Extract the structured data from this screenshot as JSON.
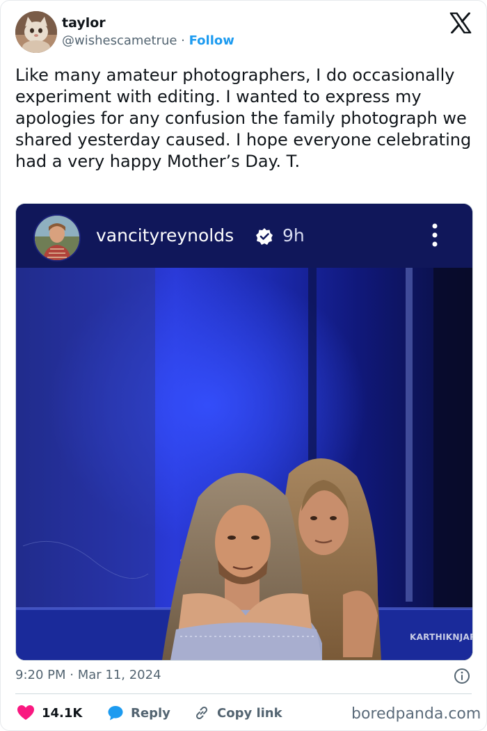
{
  "author": {
    "display_name": "taylor",
    "handle": "@wishescametrue",
    "separator": " · ",
    "follow_label": "Follow"
  },
  "tweet": {
    "text": "Like many amateur photographers, I do occasionally experiment with editing. I wanted to express my apologies for any confusion the family photograph we shared yesterday caused. I hope everyone celebrating had a very happy Mother’s Day. T."
  },
  "embedded_post": {
    "username": "vancityreynolds",
    "age": "9h",
    "watermark": "KARTHIKNJART"
  },
  "meta": {
    "time": "9:20 PM",
    "separator": " · ",
    "date": "Mar 11, 2024"
  },
  "actions": {
    "likes": "14.1K",
    "reply": "Reply",
    "copy_link": "Copy link"
  },
  "source_watermark": "boredpanda.com",
  "icons": {
    "platform": "x-logo-icon",
    "verified": "verified-badge-icon",
    "more": "more-vertical-icon",
    "info": "info-icon",
    "like": "heart-icon",
    "reply": "speech-bubble-icon",
    "link": "link-icon"
  },
  "colors": {
    "follow": "#1d9bf0",
    "like": "#f91880",
    "reply": "#1d9bf0",
    "secondary_text": "#536471",
    "ig_background": "#10175a"
  }
}
